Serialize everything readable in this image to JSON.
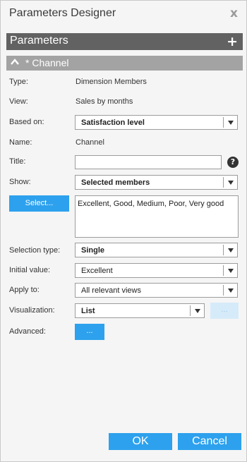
{
  "dialog": {
    "title": "Parameters Designer",
    "close_glyph": "x"
  },
  "parameters_bar": {
    "label": "Parameters",
    "add_glyph": "+"
  },
  "channel_bar": {
    "label": "* Channel"
  },
  "form": {
    "type": {
      "label": "Type:",
      "value": "Dimension Members"
    },
    "view": {
      "label": "View:",
      "value": "Sales by months"
    },
    "based_on": {
      "label": "Based on:",
      "value": "Satisfaction level"
    },
    "name": {
      "label": "Name:",
      "value": "Channel"
    },
    "title": {
      "label": "Title:",
      "value": ""
    },
    "show": {
      "label": "Show:",
      "value": "Selected members"
    },
    "select_button": "Select...",
    "members": "Excellent, Good, Medium, Poor, Very good",
    "selection_type": {
      "label": "Selection type:",
      "value": "Single"
    },
    "initial_value": {
      "label": "Initial value:",
      "value": "Excellent"
    },
    "apply_to": {
      "label": "Apply to:",
      "value": "All relevant views"
    },
    "visualization": {
      "label": "Visualization:",
      "value": "List",
      "options_button": "..."
    },
    "advanced": {
      "label": "Advanced:",
      "button": "..."
    }
  },
  "footer": {
    "ok": "OK",
    "cancel": "Cancel"
  },
  "colors": {
    "accent": "#2da1ed",
    "header_dark": "#626262",
    "header_light": "#a3a3a3"
  }
}
